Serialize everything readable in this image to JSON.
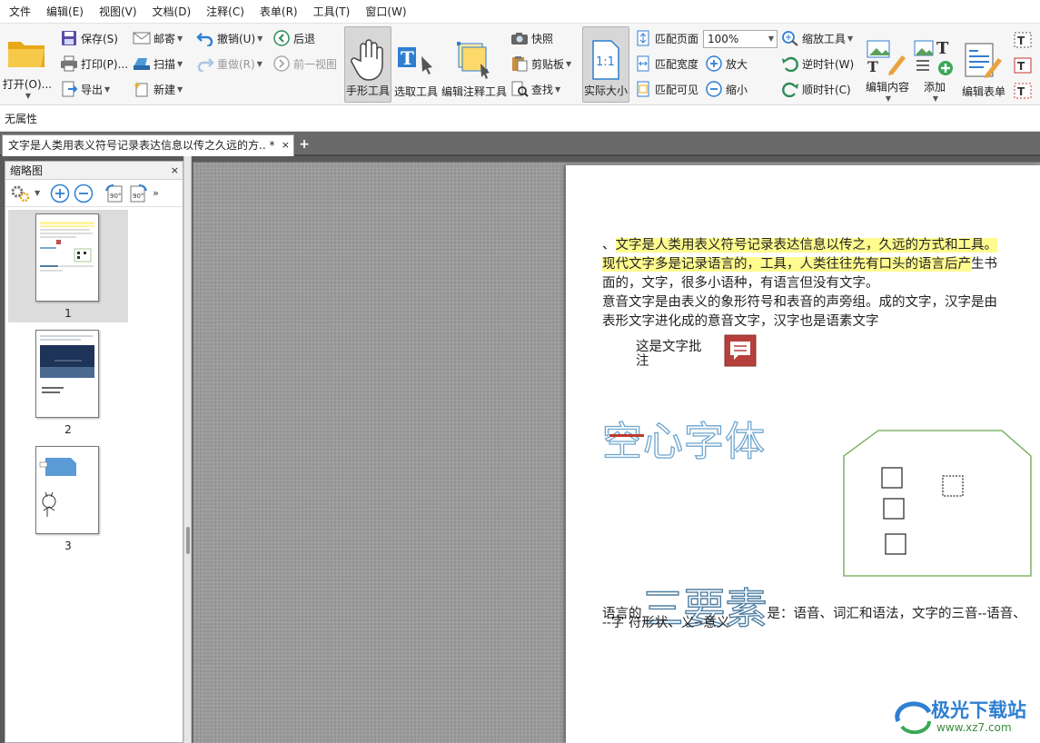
{
  "menu": [
    "文件",
    "编辑(E)",
    "视图(V)",
    "文档(D)",
    "注释(C)",
    "表单(R)",
    "工具(T)",
    "窗口(W)"
  ],
  "ribbon": {
    "open": "打开(O)...",
    "save": "保存(S)",
    "print": "打印(P)...",
    "export": "导出",
    "mail": "邮寄",
    "scan": "扫描",
    "new": "新建",
    "undo": "撤销(U)",
    "redo": "重做(R)",
    "back": "后退",
    "prev_view": "前一视图",
    "hand_tool": "手形工具",
    "select_tool": "选取工具",
    "edit_annot_tool": "编辑注释工具",
    "snapshot": "快照",
    "clipboard": "剪贴板",
    "find": "查找",
    "actual_size": "实际大小",
    "fit_page": "匹配页面",
    "fit_width": "匹配宽度",
    "fit_visible": "匹配可见",
    "zoom_value": "100%",
    "zoom_in": "放大",
    "zoom_out": "缩小",
    "zoom_tool": "缩放工具",
    "rotate_ccw": "逆时针(W)",
    "rotate_cw": "顺时针(C)",
    "edit_content": "编辑内容",
    "add": "添加",
    "edit_form": "编辑表单"
  },
  "properties_bar": "无属性",
  "tab": {
    "title": "文字是人类用表义符号记录表达信息以传之久远的方.. *",
    "close": "×",
    "new": "+"
  },
  "thumbnail_panel": {
    "title": "缩略图",
    "close": "×",
    "pages": [
      "1",
      "2",
      "3"
    ]
  },
  "document": {
    "line1_prefix": "、",
    "line1_highlight": "文字是人类用表义符号记录表达信息以传之，久远的方式和工具。",
    "line2_highlight": "现代文字多是记录语言的，工具，人类往往先有口头的语言后产",
    "line2_rest": "生书",
    "line3": "面的，文字，很多小语种，有语言但没有文字。",
    "line4": "意音文字是由表义的象形符号和表音的声旁组。成的文字，汉字是由",
    "line5": "表形文字进化成的意音文字，汉字也是语素文字",
    "annotation_line1": "这是文字批",
    "annotation_line2": "注",
    "hollow_title": "空心字体",
    "elements_prefix": "语言的",
    "elements_big": "三要素",
    "elements_rest": "是：语音、词汇和语法，文字的三音--语音、",
    "line_last": "--字  符形状、义--意义"
  },
  "watermark": {
    "name": "极光下载站",
    "url": "www.xz7.com"
  },
  "colors": {
    "highlight": "#fffb8f",
    "annotation_icon": "#b5403b",
    "shape_stroke": "#6aa84f",
    "hollow_text": "#6fa6cf",
    "accent_blue": "#2f7fd1"
  }
}
